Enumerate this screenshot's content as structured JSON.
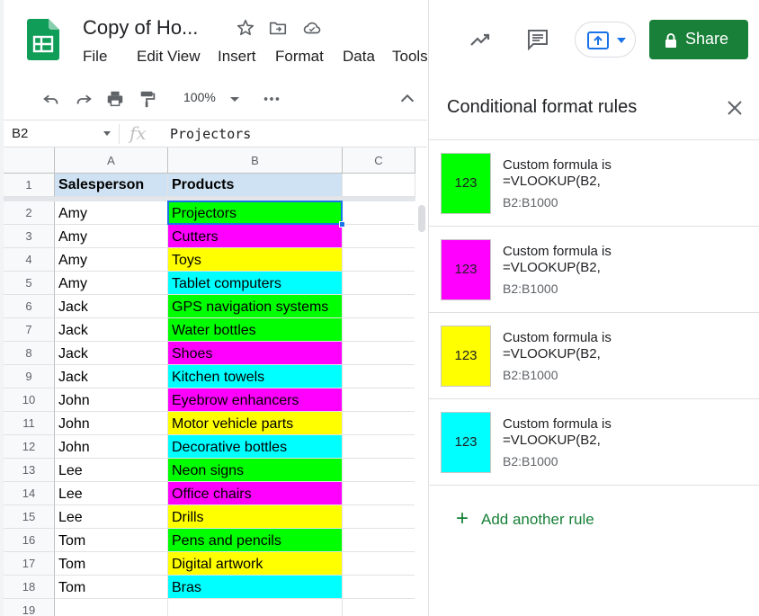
{
  "header": {
    "doc_title": "Copy of Ho...",
    "menu": [
      "File",
      "Edit",
      "View",
      "Insert",
      "Format",
      "Data",
      "Tools"
    ]
  },
  "toolbar": {
    "zoom": "100%"
  },
  "formula_bar": {
    "cell_ref": "B2",
    "fx": "fx",
    "value": "Projectors"
  },
  "grid": {
    "columns": [
      "A",
      "B",
      "C"
    ],
    "header_row": {
      "num": "1",
      "a": "Salesperson",
      "b": "Products"
    },
    "rows": [
      {
        "num": "2",
        "a": "Amy",
        "b": "Projectors",
        "color": "#00ff00"
      },
      {
        "num": "3",
        "a": "Amy",
        "b": "Cutters",
        "color": "#ff00ff"
      },
      {
        "num": "4",
        "a": "Amy",
        "b": "Toys",
        "color": "#ffff00"
      },
      {
        "num": "5",
        "a": "Amy",
        "b": "Tablet computers",
        "color": "#00ffff"
      },
      {
        "num": "6",
        "a": "Jack",
        "b": "GPS navigation systems",
        "color": "#00ff00"
      },
      {
        "num": "7",
        "a": "Jack",
        "b": "Water bottles",
        "color": "#00ff00"
      },
      {
        "num": "8",
        "a": "Jack",
        "b": "Shoes",
        "color": "#ff00ff"
      },
      {
        "num": "9",
        "a": "Jack",
        "b": "Kitchen towels",
        "color": "#00ffff"
      },
      {
        "num": "10",
        "a": "John",
        "b": "Eyebrow enhancers",
        "color": "#ff00ff"
      },
      {
        "num": "11",
        "a": "John",
        "b": "Motor vehicle parts",
        "color": "#ffff00"
      },
      {
        "num": "12",
        "a": "John",
        "b": "Decorative bottles",
        "color": "#00ffff"
      },
      {
        "num": "13",
        "a": "Lee",
        "b": "Neon signs",
        "color": "#00ff00"
      },
      {
        "num": "14",
        "a": "Lee",
        "b": "Office chairs",
        "color": "#ff00ff"
      },
      {
        "num": "15",
        "a": "Lee",
        "b": "Drills",
        "color": "#ffff00"
      },
      {
        "num": "16",
        "a": "Tom",
        "b": "Pens and pencils",
        "color": "#00ff00"
      },
      {
        "num": "17",
        "a": "Tom",
        "b": "Digital artwork",
        "color": "#ffff00"
      },
      {
        "num": "18",
        "a": "Tom",
        "b": "Bras",
        "color": "#00ffff"
      },
      {
        "num": "19",
        "a": "",
        "b": "",
        "color": ""
      }
    ]
  },
  "panel": {
    "share_label": "Share",
    "title": "Conditional format rules",
    "rules": [
      {
        "swatch_text": "123",
        "color": "#00ff00",
        "line1": "Custom formula is",
        "line2": "=VLOOKUP(B2,",
        "range": "B2:B1000"
      },
      {
        "swatch_text": "123",
        "color": "#ff00ff",
        "line1": "Custom formula is",
        "line2": "=VLOOKUP(B2,",
        "range": "B2:B1000"
      },
      {
        "swatch_text": "123",
        "color": "#ffff00",
        "line1": "Custom formula is",
        "line2": "=VLOOKUP(B2,",
        "range": "B2:B1000"
      },
      {
        "swatch_text": "123",
        "color": "#00ffff",
        "line1": "Custom formula is",
        "line2": "=VLOOKUP(B2,",
        "range": "B2:B1000"
      }
    ],
    "add_rule_label": "Add another rule"
  },
  "colors": {
    "accent_green": "#188038",
    "selection_blue": "#1a73e8",
    "header_fill": "#cfe2f3"
  }
}
